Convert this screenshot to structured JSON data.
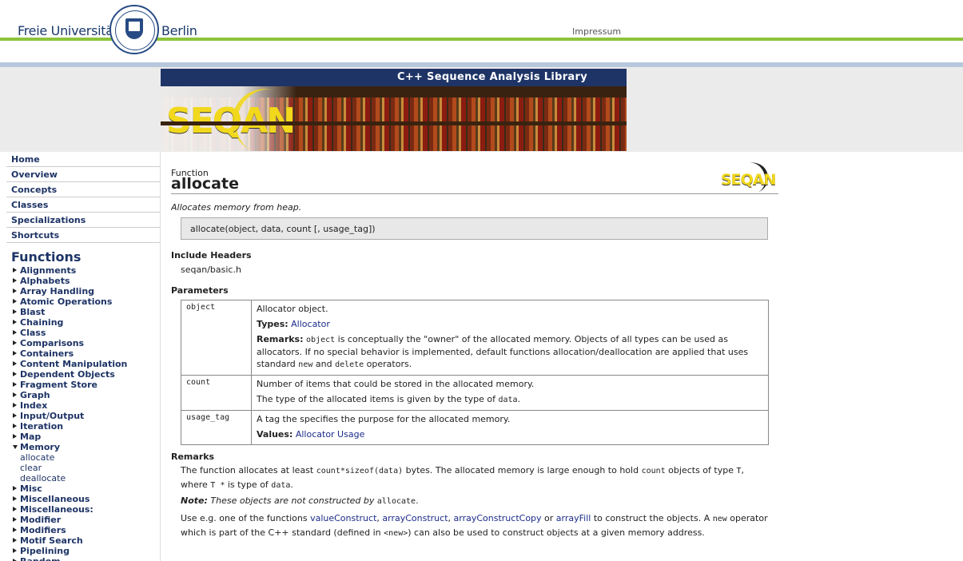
{
  "header": {
    "uni_left": "Freie Universität",
    "uni_right": "Berlin",
    "impressum": "Impressum"
  },
  "banner": {
    "title": "C++ Sequence Analysis Library",
    "logo_text": "SEQAN"
  },
  "sidebar": {
    "nav": [
      "Home",
      "Overview",
      "Concepts",
      "Classes",
      "Specializations",
      "Shortcuts"
    ],
    "functions_heading": "Functions",
    "categories": [
      {
        "label": "Alignments",
        "expanded": false
      },
      {
        "label": "Alphabets",
        "expanded": false
      },
      {
        "label": "Array Handling",
        "expanded": false
      },
      {
        "label": "Atomic Operations",
        "expanded": false
      },
      {
        "label": "Blast",
        "expanded": false
      },
      {
        "label": "Chaining",
        "expanded": false
      },
      {
        "label": "Class",
        "expanded": false
      },
      {
        "label": "Comparisons",
        "expanded": false
      },
      {
        "label": "Containers",
        "expanded": false
      },
      {
        "label": "Content Manipulation",
        "expanded": false
      },
      {
        "label": "Dependent Objects",
        "expanded": false
      },
      {
        "label": "Fragment Store",
        "expanded": false
      },
      {
        "label": "Graph",
        "expanded": false
      },
      {
        "label": "Index",
        "expanded": false
      },
      {
        "label": "Input/Output",
        "expanded": false
      },
      {
        "label": "Iteration",
        "expanded": false
      },
      {
        "label": "Map",
        "expanded": false
      },
      {
        "label": "Memory",
        "expanded": true,
        "children": [
          "allocate",
          "clear",
          "deallocate"
        ]
      },
      {
        "label": "Misc",
        "expanded": false
      },
      {
        "label": "Miscellaneous",
        "expanded": false
      },
      {
        "label": "Miscellaneous:",
        "expanded": false
      },
      {
        "label": "Modifier",
        "expanded": false
      },
      {
        "label": "Modifiers",
        "expanded": false
      },
      {
        "label": "Motif Search",
        "expanded": false
      },
      {
        "label": "Pipelining",
        "expanded": false
      },
      {
        "label": "Random",
        "expanded": false
      }
    ]
  },
  "main": {
    "kind": "Function",
    "title": "allocate",
    "logo_text": "SEQAN",
    "summary": "Allocates memory from heap.",
    "signature": "allocate(object, data, count [, usage_tag])",
    "include_heading": "Include Headers",
    "include_file": "seqan/basic.h",
    "params_heading": "Parameters",
    "params": {
      "object": {
        "name": "object",
        "desc": "Allocator object.",
        "types_label": "Types:",
        "types_link": "Allocator",
        "remarks_label": "Remarks:",
        "remarks_code": "object",
        "remarks_text_1": " is conceptually the \"owner\" of the allocated memory. Objects of all types can be used as allocators. If no special behavior is implemented, default functions allocation/deallocation are applied that uses standard ",
        "remarks_code_new": "new",
        "remarks_text_and": " and ",
        "remarks_code_delete": "delete",
        "remarks_text_end": " operators."
      },
      "count": {
        "name": "count",
        "desc": "Number of items that could be stored in the allocated memory.",
        "desc2": "The type of the allocated items is given by the type of ",
        "desc2_code": "data",
        "desc2_end": "."
      },
      "usage_tag": {
        "name": "usage_tag",
        "desc": "A tag the specifies the purpose for the allocated memory.",
        "values_label": "Values:",
        "values_link": "Allocator Usage"
      }
    },
    "remarks_heading": "Remarks",
    "remarks": {
      "p1_a": "The function allocates at least ",
      "p1_code1": "count*sizeof(data)",
      "p1_b": " bytes. The allocated memory is large enough to hold ",
      "p1_code2": "count",
      "p1_c": " objects of type ",
      "p1_code3": "T",
      "p1_d": ", where ",
      "p1_code4": "T *",
      "p1_e": " is type of ",
      "p1_code5": "data",
      "p1_f": ".",
      "note_label": "Note:",
      "note_text": " These objects are not constructed by ",
      "note_code": "allocate",
      "note_end": ".",
      "p3_a": "Use e.g. one of the functions ",
      "p3_link1": "valueConstruct",
      "p3_sep1": ", ",
      "p3_link2": "arrayConstruct",
      "p3_sep2": ", ",
      "p3_link3": "arrayConstructCopy",
      "p3_or": " or ",
      "p3_link4": "arrayFill",
      "p3_b": " to construct the objects. A ",
      "p3_code1": "new",
      "p3_c": " operator which is part of the C++ standard (defined in ",
      "p3_code2": "<new>",
      "p3_d": ") can also be used to construct objects at a given memory address."
    }
  }
}
